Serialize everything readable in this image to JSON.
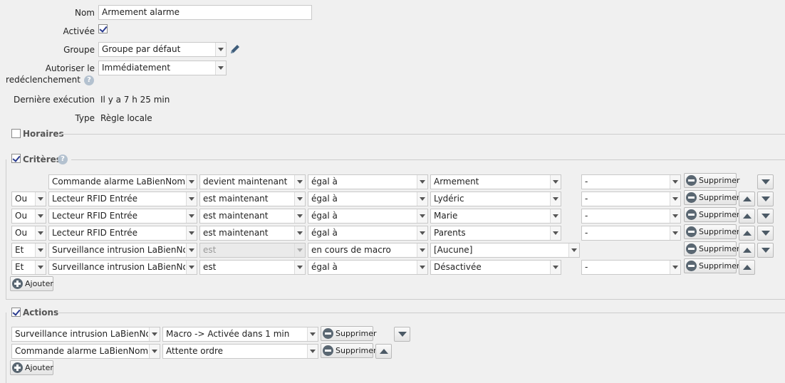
{
  "form": {
    "nom_label": "Nom",
    "nom_value": "Armement alarme",
    "activee_label": "Activée",
    "groupe_label": "Groupe",
    "groupe_value": "Groupe par défaut",
    "autoriser_label_1": "Autoriser le",
    "autoriser_label_2": "redéclenchement",
    "autoriser_value": "Immédiatement",
    "derniere_label": "Dernière exécution",
    "derniere_value": "Il y a 7 h 25 min",
    "type_label": "Type",
    "type_value": "Règle locale"
  },
  "sections": {
    "horaires": "Horaires",
    "criteres": "Critères",
    "actions": "Actions"
  },
  "criteria": [
    {
      "logic": "",
      "device": "Commande alarme LaBienNommée",
      "verb": "devient maintenant",
      "op": "égal à",
      "value": "Armement",
      "extra": "-",
      "up": false,
      "down": true
    },
    {
      "logic": "Ou",
      "device": "Lecteur RFID Entrée",
      "verb": "est maintenant",
      "op": "égal à",
      "value": "Lydéric",
      "extra": "-",
      "up": true,
      "down": true
    },
    {
      "logic": "Ou",
      "device": "Lecteur RFID Entrée",
      "verb": "est maintenant",
      "op": "égal à",
      "value": "Marie",
      "extra": "-",
      "up": true,
      "down": true
    },
    {
      "logic": "Ou",
      "device": "Lecteur RFID Entrée",
      "verb": "est maintenant",
      "op": "égal à",
      "value": "Parents",
      "extra": "-",
      "up": true,
      "down": true
    },
    {
      "logic": "Et",
      "device": "Surveillance intrusion LaBienNommée",
      "verb": "est",
      "op": "en cours de macro",
      "value": "[Aucune]",
      "extra": "",
      "up": true,
      "down": true
    },
    {
      "logic": "Et",
      "device": "Surveillance intrusion LaBienNommée",
      "verb": "est",
      "op": "égal à",
      "value": "Désactivée",
      "extra": "-",
      "up": true,
      "down": false
    }
  ],
  "actions": [
    {
      "device": "Surveillance intrusion LaBienNommée",
      "action": "Macro -> Activée dans 1 min",
      "up": false,
      "down": true
    },
    {
      "device": "Commande alarme LaBienNommée",
      "action": "Attente ordre",
      "up": true,
      "down": false
    }
  ],
  "buttons": {
    "supprimer": "Supprimer",
    "ajouter": "Ajouter"
  },
  "help_glyph": "?"
}
